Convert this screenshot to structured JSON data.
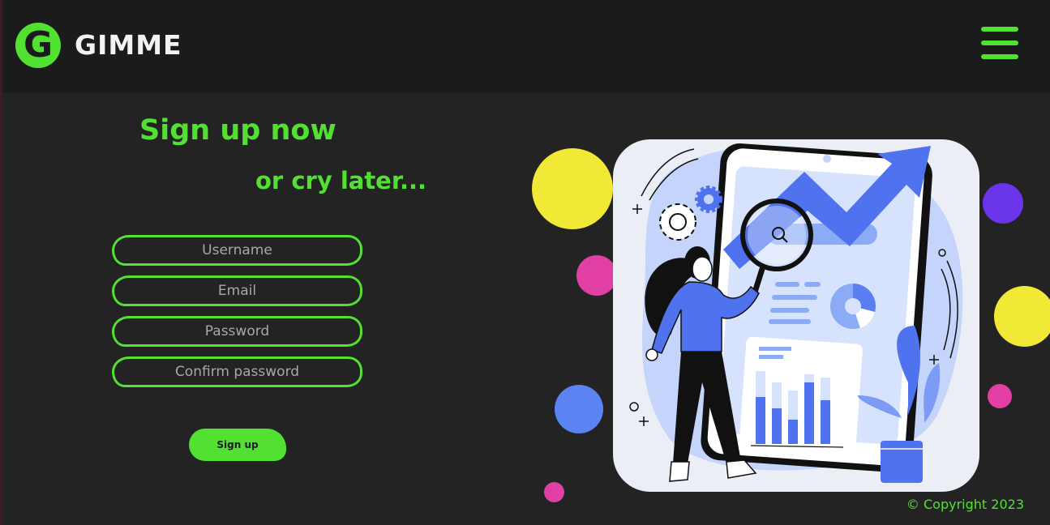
{
  "header": {
    "logo_letter": "G",
    "brand_name": "GIMME",
    "menu_icon": "hamburger-menu-icon",
    "accent_color": "#52e033"
  },
  "hero": {
    "headline": "Sign up now",
    "subline": "or cry later..."
  },
  "form": {
    "username_placeholder": "Username",
    "email_placeholder": "Email",
    "password_placeholder": "Password",
    "confirm_password_placeholder": "Confirm password",
    "submit_label": "Sign up"
  },
  "illustration": {
    "subject": "woman-with-magnifier-analytics-illustration"
  },
  "footer": {
    "copyright": "© Copyright 2023"
  },
  "colors": {
    "background": "#232323",
    "navbar": "#1b1b1b",
    "yellow": "#f2e936",
    "pink": "#e23fa5",
    "purple": "#6a35e8",
    "blue": "#5b84f2"
  }
}
